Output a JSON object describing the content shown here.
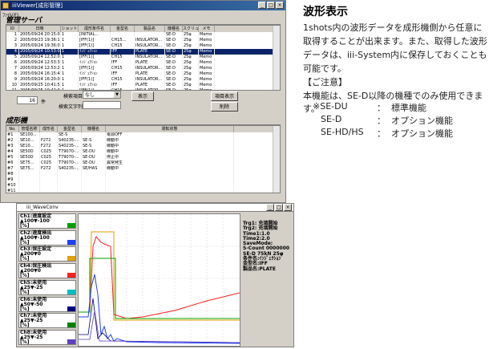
{
  "main_window": {
    "title": "iiiViewer[成形管理]",
    "menu": "ﾌｧｲﾙ(F)",
    "section_server": "管理サーバ",
    "section_machine": "成形機",
    "server_table": {
      "headers": [
        "ID",
        "日時",
        "ショット",
        "成形条件名",
        "金型名",
        "製品名",
        "機種名",
        "スクリュ径",
        "メモ"
      ],
      "rows": [
        [
          "1",
          "2005/09/24 20:15:04",
          "1",
          "[INITIAL...",
          "",
          "",
          "SE-D",
          "25φ",
          "Memo"
        ],
        [
          "2",
          "2005/09/23 19:36:12",
          "1",
          "[IFF(1)]",
          "CH15...",
          "INSULATOR...",
          "SE-D",
          "25φ",
          "Memo"
        ],
        [
          "3",
          "2005/09/24 19:36:05",
          "1",
          "[IFF(1)]",
          "CH15",
          "INSULATOR...",
          "SE-D",
          "25φ",
          "Memo"
        ],
        [
          "4",
          "2005/09/24 10:53:04",
          "1",
          "ｲﾝｼﾞｪｸｼｮﾝ",
          "IFF",
          "PLATE",
          "SE-D",
          "25φ",
          "Memo"
        ],
        [
          "5",
          "2005/09/24 12:52:02",
          "1",
          "[IFF(1)]",
          "CH15",
          "INSULATOR...",
          "SE-D",
          "25φ",
          "Memo"
        ],
        [
          "6",
          "2005/09/24 12:53:36",
          "1",
          "ｲﾝｼﾞｪｸｼｮﾝ",
          "IFF",
          "PLATE",
          "SE-D",
          "25φ",
          "Memo"
        ],
        [
          "7",
          "2005/09/24 12:53:25",
          "1",
          "[IFF(1)]",
          "CH15",
          "INSULATOR...",
          "SE-D",
          "25φ",
          "Memo"
        ],
        [
          "8",
          "2005/09/24 16:15:46",
          "1",
          "ｲﾝｼﾞｪｸｼｮﾝ",
          "IFF",
          "PLATE",
          "SE-D",
          "25φ",
          "Memo"
        ],
        [
          "9",
          "2005/09/24 16:20:00",
          "1",
          "[IFF(1)]",
          "CH15",
          "INSULATOR...",
          "SE-D",
          "25φ",
          "Memo"
        ],
        [
          "10",
          "2005/09/25 10:41:52",
          "1",
          "ｲﾝｼﾞｪｸｼｮﾝ",
          "IFF",
          "PLATE",
          "SE-D",
          "25φ",
          "Memo"
        ],
        [
          "11",
          "2005/09/25 10:42:04",
          "1",
          "[IFF(1)]",
          "CH15",
          "INSULATOR...",
          "SE-D",
          "25φ",
          "Memo"
        ],
        [
          "12",
          "2005/09/25 10:44:01",
          "1",
          "ｲﾝｼﾞｪｸｼｮﾝ",
          "IFF",
          "PLATE",
          "SE-D",
          "25φ",
          "Memo"
        ]
      ],
      "selected_index": 3
    },
    "count_value": "16",
    "count_unit": "件",
    "search_item_label": "検索項目",
    "search_item_value": "なし",
    "search_text_label": "検索文字列",
    "display_button": "表示",
    "item_display_button": "項目表示",
    "delete_button": "削除",
    "machine_table": {
      "headers": [
        "No.",
        "管理名称",
        "成形名",
        "金型名",
        "機種名",
        "運転状態"
      ],
      "rows": [
        [
          "#1",
          "SE100...",
          "",
          "SE-S",
          "",
          "電源OFF"
        ],
        [
          "#2",
          "SE10...",
          "F272",
          "S40235-...",
          "SE-S",
          "稼動中"
        ],
        [
          "#3",
          "SE10...",
          "F272",
          "S40235-...",
          "SE-S",
          "稼動中"
        ],
        [
          "#4",
          "SE50D",
          "C025",
          "T79070-...",
          "SE-DU",
          "稼動中"
        ],
        [
          "#5",
          "SE50D",
          "C025",
          "T79070-...",
          "SE-DU",
          "停止中"
        ],
        [
          "#6",
          "SE75...",
          "C025",
          "T79070-...",
          "SE-DU",
          "異常発生"
        ],
        [
          "#7",
          "SE75...",
          "F272",
          "S40235-...",
          "SE/HAS",
          "稼動中"
        ],
        [
          "#8",
          "",
          "",
          "",
          "",
          ""
        ],
        [
          "#9",
          "",
          "",
          "",
          "",
          ""
        ],
        [
          "#10",
          "",
          "",
          "",
          "",
          ""
        ],
        [
          "#11",
          "",
          "",
          "",
          "",
          ""
        ]
      ]
    }
  },
  "wave_window": {
    "title": "iii_WaveConv",
    "channels": [
      {
        "name": "Ch1:速度設定",
        "range": "▲100▼-100",
        "unit": "[%]",
        "color": "#00a000"
      },
      {
        "name": "Ch2:速度検出",
        "range": "▲100▼-100",
        "unit": "[%]",
        "color": "#2040ff"
      },
      {
        "name": "Ch3:保圧設定",
        "range": "▲200▼0",
        "unit": "[%]",
        "color": "#e0a000"
      },
      {
        "name": "Ch4:保圧検出",
        "range": "▲200▼0",
        "unit": "[%]",
        "color": "#ff2020"
      },
      {
        "name": "Ch5:未使用",
        "range": "▲25▼-25",
        "unit": "[%]",
        "color": "#00c0c0"
      },
      {
        "name": "Ch6:未使用",
        "range": "▲50▼-50",
        "unit": "[%]",
        "color": "#000080"
      },
      {
        "name": "Ch7:未使用",
        "range": "▲25▼-25",
        "unit": "[%]",
        "color": "#008000"
      },
      {
        "name": "Ch8:未使用",
        "range": "▲25▼-25",
        "unit": "[%]",
        "color": "#6040c0"
      }
    ],
    "info_lines": [
      "Trg1: 充填開始",
      "Trg2: 充填開始",
      "Time1:1.0",
      "Time2:2.0",
      "SaveMode:",
      "S-Count 0000000",
      "SE-D  75kN 25φ",
      "条件名:ｲﾝｼﾞｪｸｼｮﾝ",
      "金型名:IFF",
      "製品名:PLATE"
    ]
  },
  "right_panel": {
    "title": "波形表示",
    "paragraph": [
      "1shots内の波形データを成形機側から任意に",
      "取得することが出来ます。また、取得した波形",
      "データは、iii-System内に保存しておくことも",
      "可能です。"
    ],
    "note_title": "【ご注意】",
    "note_text": "本機能は、SE-D以降の機種でのみ使用できます。",
    "features": [
      {
        "model": "※SE-DU",
        "colon": "：",
        "desc": "標準機能"
      },
      {
        "model": "SE-D",
        "colon": "：",
        "desc": "オプション機能"
      },
      {
        "model": "SE-HD/HS",
        "colon": "：",
        "desc": "オプション機能"
      }
    ]
  }
}
